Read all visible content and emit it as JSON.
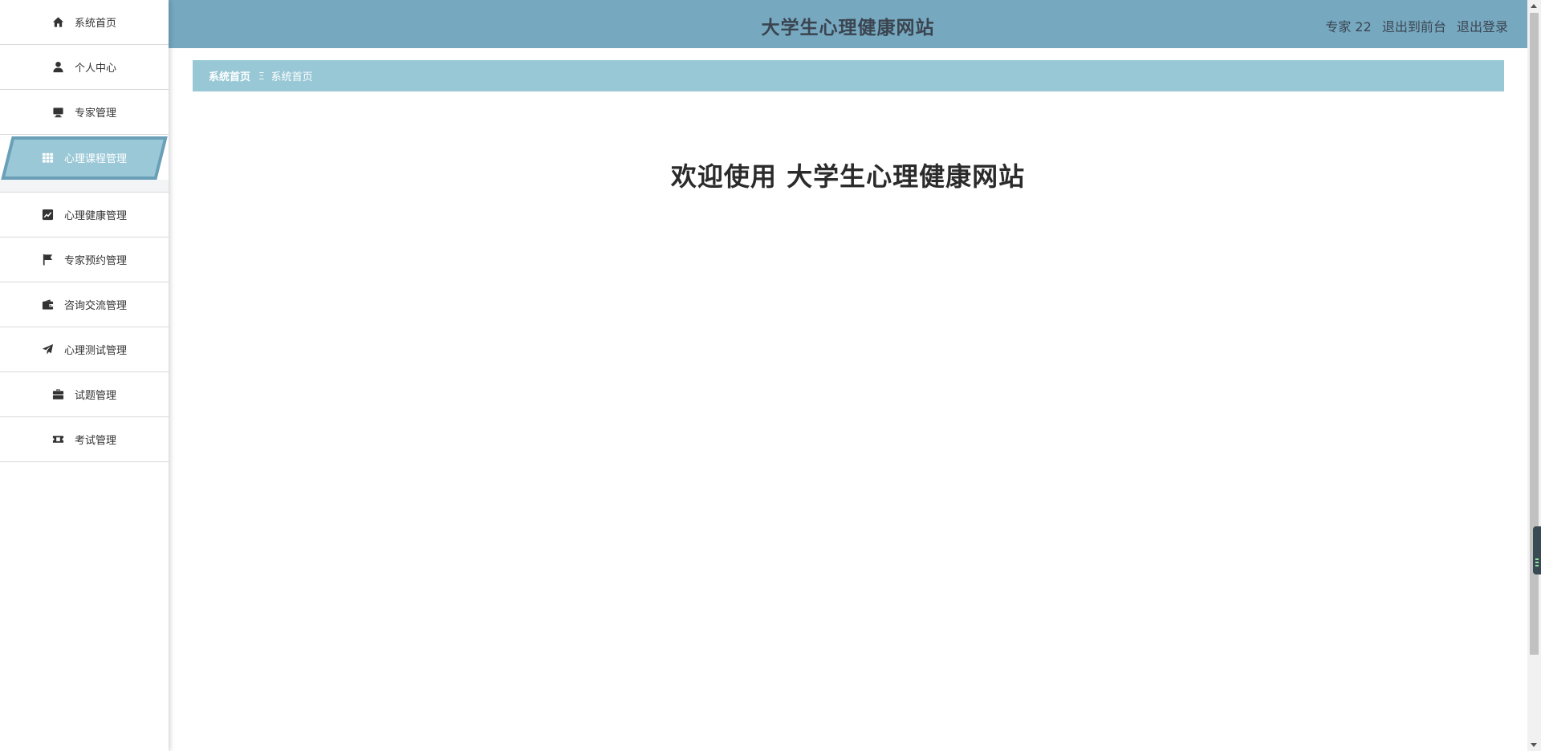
{
  "header": {
    "site_title": "大学生心理健康网站",
    "user_label": "专家 22",
    "back_to_front": "退出到前台",
    "logout": "退出登录"
  },
  "sidebar": {
    "items": [
      {
        "label": "系统首页",
        "icon": "home-icon"
      },
      {
        "label": "个人中心",
        "icon": "user-icon"
      },
      {
        "label": "专家管理",
        "icon": "monitor-icon"
      },
      {
        "label": "心理课程管理",
        "icon": "grid-icon",
        "active": true
      },
      {
        "label": "心理健康管理",
        "icon": "chart-icon"
      },
      {
        "label": "专家预约管理",
        "icon": "flag-icon"
      },
      {
        "label": "咨询交流管理",
        "icon": "wallet-icon"
      },
      {
        "label": "心理测试管理",
        "icon": "paper-plane-icon"
      },
      {
        "label": "试题管理",
        "icon": "briefcase-icon"
      },
      {
        "label": "考试管理",
        "icon": "ticket-icon"
      }
    ]
  },
  "breadcrumb": {
    "home": "系统首页",
    "separator": "Ξ",
    "current": "系统首页"
  },
  "main": {
    "welcome": "欢迎使用 大学生心理健康网站"
  },
  "colors": {
    "header_bg": "#76a8c0",
    "breadcrumb_bg": "#98c8d6",
    "active_item_bg": "#9ac8d7",
    "active_item_border": "#6a9fb8"
  }
}
